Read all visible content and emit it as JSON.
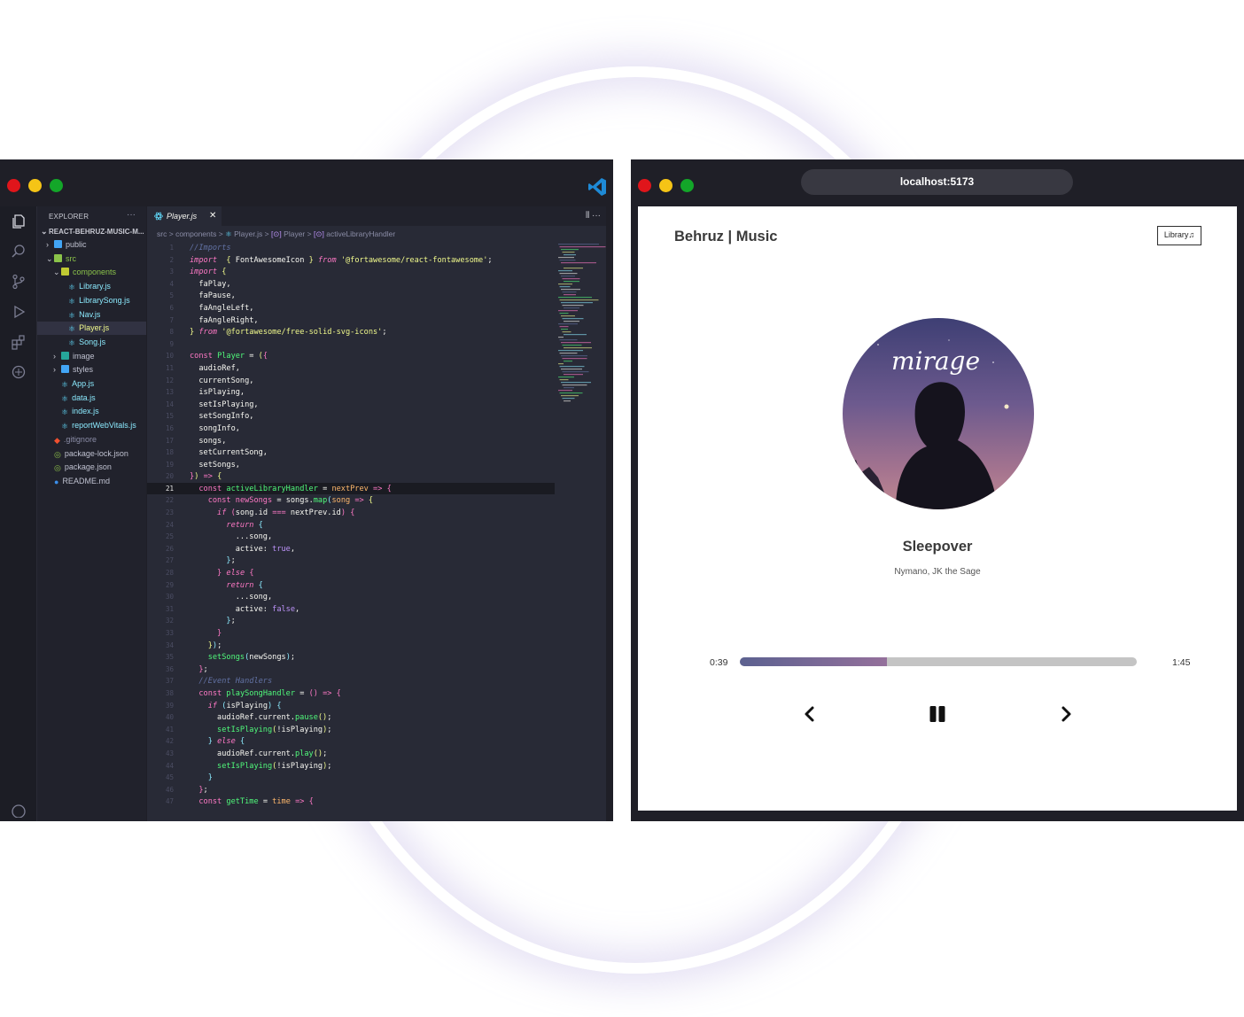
{
  "editor": {
    "explorer_title": "EXPLORER",
    "project": "REACT-BEHRUZ-MUSIC-M...",
    "tree": [
      {
        "label": "public",
        "type": "folder",
        "depth": 1,
        "open": false
      },
      {
        "label": "src",
        "type": "folder",
        "depth": 1,
        "open": true
      },
      {
        "label": "components",
        "type": "folder",
        "depth": 2,
        "open": true
      },
      {
        "label": "Library.js",
        "type": "react",
        "depth": 3
      },
      {
        "label": "LibrarySong.js",
        "type": "react",
        "depth": 3
      },
      {
        "label": "Nav.js",
        "type": "react",
        "depth": 3
      },
      {
        "label": "Player.js",
        "type": "react",
        "depth": 3,
        "selected": true
      },
      {
        "label": "Song.js",
        "type": "react",
        "depth": 3
      },
      {
        "label": "image",
        "type": "folder",
        "depth": 2,
        "open": false
      },
      {
        "label": "styles",
        "type": "folder",
        "depth": 2,
        "open": false
      },
      {
        "label": "App.js",
        "type": "react",
        "depth": 2
      },
      {
        "label": "data.js",
        "type": "react",
        "depth": 2
      },
      {
        "label": "index.js",
        "type": "react",
        "depth": 2
      },
      {
        "label": "reportWebVitals.js",
        "type": "react",
        "depth": 2
      },
      {
        "label": ".gitignore",
        "type": "git",
        "depth": 1
      },
      {
        "label": "package-lock.json",
        "type": "json",
        "depth": 1
      },
      {
        "label": "package.json",
        "type": "json",
        "depth": 1
      },
      {
        "label": "README.md",
        "type": "info",
        "depth": 1
      }
    ],
    "tab": {
      "label": "Player.js",
      "close": "✕"
    },
    "tab_actions": "⫴ ···",
    "breadcrumb": {
      "src": "src",
      "components": "components",
      "file": "Player.js",
      "symbol1": "Player",
      "symbol2": "activeLibraryHandler",
      "sep": ">",
      "symbol_icon": "[⊙]"
    },
    "active_line": 21,
    "code": [
      [
        [
          "c",
          "//Imports"
        ]
      ],
      [
        [
          "ki",
          "import"
        ],
        [
          "",
          "  "
        ],
        [
          "br1",
          "{"
        ],
        [
          "",
          " FontAwesomeIcon "
        ],
        [
          "br1",
          "}"
        ],
        [
          "",
          " "
        ],
        [
          "ki",
          "from"
        ],
        [
          "",
          " "
        ],
        [
          "s",
          "'@fortawesome/react-fontawesome'"
        ],
        [
          "",
          ";"
        ]
      ],
      [
        [
          "ki",
          "import"
        ],
        [
          "",
          " "
        ],
        [
          "br1",
          "{"
        ]
      ],
      [
        [
          "",
          "  faPlay,"
        ]
      ],
      [
        [
          "",
          "  faPause,"
        ]
      ],
      [
        [
          "",
          "  faAngleLeft,"
        ]
      ],
      [
        [
          "",
          "  faAngleRight,"
        ]
      ],
      [
        [
          "br1",
          "}"
        ],
        [
          "",
          " "
        ],
        [
          "ki",
          "from"
        ],
        [
          "",
          " "
        ],
        [
          "s",
          "'@fortawesome/free-solid-svg-icons'"
        ],
        [
          "",
          ";"
        ]
      ],
      [
        [
          "",
          ""
        ]
      ],
      [
        [
          "k",
          "const"
        ],
        [
          "",
          " "
        ],
        [
          "f",
          "Player"
        ],
        [
          "",
          " = "
        ],
        [
          "br1",
          "("
        ],
        [
          "br2",
          "{"
        ]
      ],
      [
        [
          "",
          "  audioRef,"
        ]
      ],
      [
        [
          "",
          "  currentSong,"
        ]
      ],
      [
        [
          "",
          "  isPlaying,"
        ]
      ],
      [
        [
          "",
          "  setIsPlaying,"
        ]
      ],
      [
        [
          "",
          "  setSongInfo,"
        ]
      ],
      [
        [
          "",
          "  songInfo,"
        ]
      ],
      [
        [
          "",
          "  songs,"
        ]
      ],
      [
        [
          "",
          "  setCurrentSong,"
        ]
      ],
      [
        [
          "",
          "  setSongs,"
        ]
      ],
      [
        [
          "br2",
          "}"
        ],
        [
          "br1",
          ")"
        ],
        [
          "",
          " "
        ],
        [
          "k",
          "=>"
        ],
        [
          "",
          " "
        ],
        [
          "br1",
          "{"
        ]
      ],
      [
        [
          "",
          "  "
        ],
        [
          "k",
          "const"
        ],
        [
          "",
          " "
        ],
        [
          "f",
          "activeLibraryHandler"
        ],
        [
          "",
          " = "
        ],
        [
          "o",
          "nextPrev"
        ],
        [
          "",
          " "
        ],
        [
          "k",
          "=>"
        ],
        [
          "",
          " "
        ],
        [
          "br2",
          "{"
        ]
      ],
      [
        [
          "",
          "    "
        ],
        [
          "k",
          "const"
        ],
        [
          "",
          " "
        ],
        [
          "pn",
          "newSongs"
        ],
        [
          "",
          " = songs."
        ],
        [
          "f",
          "map"
        ],
        [
          "br3",
          "("
        ],
        [
          "o",
          "song"
        ],
        [
          "",
          " "
        ],
        [
          "k",
          "=>"
        ],
        [
          "",
          " "
        ],
        [
          "br1",
          "{"
        ]
      ],
      [
        [
          "",
          "      "
        ],
        [
          "ki",
          "if"
        ],
        [
          "",
          " "
        ],
        [
          "br2",
          "("
        ],
        [
          "",
          "song.id "
        ],
        [
          "k",
          "==="
        ],
        [
          "",
          " nextPrev.id"
        ],
        [
          "br2",
          ")"
        ],
        [
          "",
          " "
        ],
        [
          "br2",
          "{"
        ]
      ],
      [
        [
          "",
          "        "
        ],
        [
          "ki",
          "return"
        ],
        [
          "",
          " "
        ],
        [
          "br3",
          "{"
        ]
      ],
      [
        [
          "",
          "          ...song,"
        ]
      ],
      [
        [
          "",
          "          active: "
        ],
        [
          "v",
          "true"
        ],
        [
          "",
          ","
        ]
      ],
      [
        [
          "",
          "        "
        ],
        [
          "br3",
          "}"
        ],
        [
          "",
          ";"
        ]
      ],
      [
        [
          "",
          "      "
        ],
        [
          "br2",
          "}"
        ],
        [
          "",
          " "
        ],
        [
          "ki",
          "else"
        ],
        [
          "",
          " "
        ],
        [
          "br2",
          "{"
        ]
      ],
      [
        [
          "",
          "        "
        ],
        [
          "ki",
          "return"
        ],
        [
          "",
          " "
        ],
        [
          "br3",
          "{"
        ]
      ],
      [
        [
          "",
          "          ...song,"
        ]
      ],
      [
        [
          "",
          "          active: "
        ],
        [
          "v",
          "false"
        ],
        [
          "",
          ","
        ]
      ],
      [
        [
          "",
          "        "
        ],
        [
          "br3",
          "}"
        ],
        [
          "",
          ";"
        ]
      ],
      [
        [
          "",
          "      "
        ],
        [
          "br2",
          "}"
        ]
      ],
      [
        [
          "",
          "    "
        ],
        [
          "br1",
          "}"
        ],
        [
          "br3",
          ")"
        ],
        [
          "",
          ";"
        ]
      ],
      [
        [
          "",
          "    "
        ],
        [
          "f",
          "setSongs"
        ],
        [
          "br3",
          "("
        ],
        [
          "",
          "newSongs"
        ],
        [
          "br3",
          ")"
        ],
        [
          "",
          ";"
        ]
      ],
      [
        [
          "",
          "  "
        ],
        [
          "br2",
          "}"
        ],
        [
          "",
          ";"
        ]
      ],
      [
        [
          "",
          "  "
        ],
        [
          "c",
          "//Event Handlers"
        ]
      ],
      [
        [
          "",
          "  "
        ],
        [
          "k",
          "const"
        ],
        [
          "",
          " "
        ],
        [
          "f",
          "playSongHandler"
        ],
        [
          "",
          " = "
        ],
        [
          "br2",
          "()"
        ],
        [
          "",
          " "
        ],
        [
          "k",
          "=>"
        ],
        [
          "",
          " "
        ],
        [
          "br2",
          "{"
        ]
      ],
      [
        [
          "",
          "    "
        ],
        [
          "ki",
          "if"
        ],
        [
          "",
          " "
        ],
        [
          "br3",
          "("
        ],
        [
          "",
          "isPlaying"
        ],
        [
          "br3",
          ")"
        ],
        [
          "",
          " "
        ],
        [
          "br3",
          "{"
        ]
      ],
      [
        [
          "",
          "      audioRef.current."
        ],
        [
          "f",
          "pause"
        ],
        [
          "br1",
          "()"
        ],
        [
          "",
          ";"
        ]
      ],
      [
        [
          "",
          "      "
        ],
        [
          "f",
          "setIsPlaying"
        ],
        [
          "br1",
          "("
        ],
        [
          "",
          "!isPlaying"
        ],
        [
          "br1",
          ")"
        ],
        [
          "",
          ";"
        ]
      ],
      [
        [
          "",
          "    "
        ],
        [
          "br3",
          "}"
        ],
        [
          "",
          " "
        ],
        [
          "ki",
          "else"
        ],
        [
          "",
          " "
        ],
        [
          "br3",
          "{"
        ]
      ],
      [
        [
          "",
          "      audioRef.current."
        ],
        [
          "f",
          "play"
        ],
        [
          "br1",
          "()"
        ],
        [
          "",
          ";"
        ]
      ],
      [
        [
          "",
          "      "
        ],
        [
          "f",
          "setIsPlaying"
        ],
        [
          "br1",
          "("
        ],
        [
          "",
          "!isPlaying"
        ],
        [
          "br1",
          ")"
        ],
        [
          "",
          ";"
        ]
      ],
      [
        [
          "",
          "    "
        ],
        [
          "br3",
          "}"
        ]
      ],
      [
        [
          "",
          "  "
        ],
        [
          "br2",
          "}"
        ],
        [
          "",
          ";"
        ]
      ],
      [
        [
          "",
          "  "
        ],
        [
          "k",
          "const"
        ],
        [
          "",
          " "
        ],
        [
          "f",
          "getTime"
        ],
        [
          "",
          " = "
        ],
        [
          "o",
          "time"
        ],
        [
          "",
          " "
        ],
        [
          "k",
          "=>"
        ],
        [
          "",
          " "
        ],
        [
          "br2",
          "{"
        ]
      ]
    ]
  },
  "browser": {
    "url": "localhost:5173",
    "brand": "Behruz | Music",
    "library_button": "Library",
    "cover_text": "mirage",
    "song": {
      "title": "Sleepover",
      "artist": "Nymano, JK the Sage"
    },
    "current_time": "0:39",
    "duration": "1:45",
    "progress": 0.37
  },
  "colors": {
    "accent_vscode": "#0a84ff",
    "red": "#e0151b",
    "yellow": "#f5c416",
    "green": "#13a629",
    "progress_fill": "#7d6897"
  }
}
